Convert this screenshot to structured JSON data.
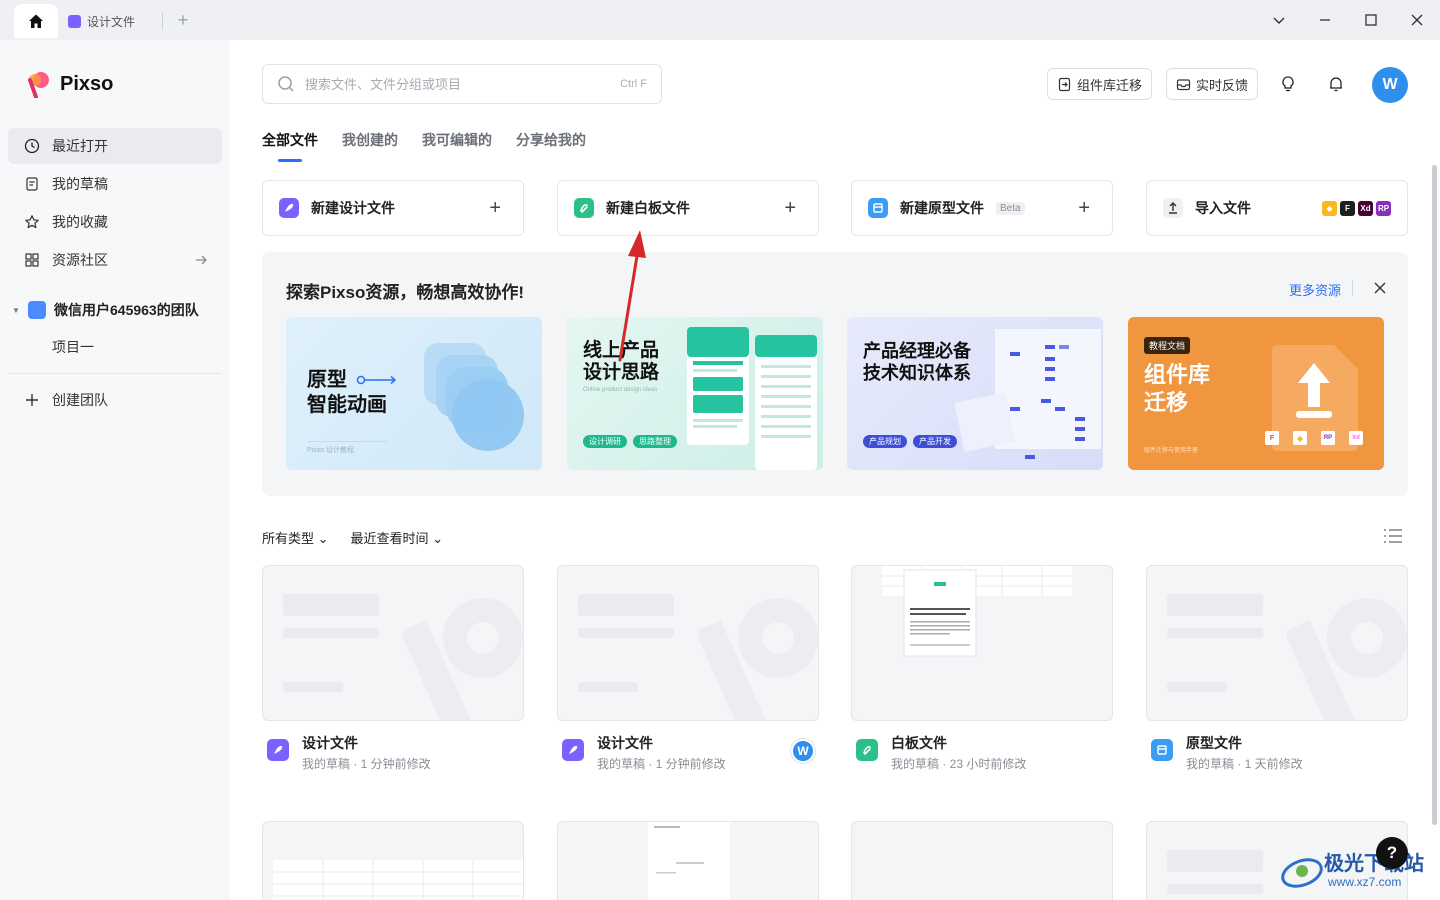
{
  "titlebar": {
    "tab_label": "设计文件",
    "new_tab": "+"
  },
  "app": {
    "name": "Pixso"
  },
  "sidebar": {
    "items": [
      {
        "label": "最近打开",
        "icon": "clock-icon"
      },
      {
        "label": "我的草稿",
        "icon": "draft-icon"
      },
      {
        "label": "我的收藏",
        "icon": "star-icon"
      },
      {
        "label": "资源社区",
        "icon": "grid-icon"
      }
    ],
    "team_name": "微信用户645963的团队",
    "project": "项目一",
    "create_team": "创建团队"
  },
  "search": {
    "placeholder": "搜索文件、文件分组或项目",
    "shortcut": "Ctrl F"
  },
  "header": {
    "migrate_btn": "组件库迁移",
    "feedback_btn": "实时反馈",
    "avatar": "W"
  },
  "tabs": [
    "全部文件",
    "我创建的",
    "我可编辑的",
    "分享给我的"
  ],
  "new_cards": [
    {
      "label": "新建设计文件",
      "color": "#7b61ff"
    },
    {
      "label": "新建白板文件",
      "color": "#2ec08a"
    },
    {
      "label": "新建原型文件",
      "badge": "Beta",
      "color": "#3b9cf5"
    },
    {
      "label": "导入文件",
      "logos": [
        "Xd",
        "RP"
      ]
    }
  ],
  "explore": {
    "title": "探索Pixso资源，畅想高效协作!",
    "more": "更多资源",
    "banners": [
      {
        "title_line1": "原型",
        "title_line2": "智能动画",
        "footer": "Pixso 设计教程"
      },
      {
        "title_line1": "线上产品",
        "title_line2": "设计思路",
        "subtitle": "Online product design ideas",
        "tags": [
          "设计调研",
          "思路整理"
        ]
      },
      {
        "title_line1": "产品经理必备",
        "title_line2": "技术知识体系",
        "tags": [
          "产品规划",
          "产品开发"
        ]
      },
      {
        "badge": "教程文档",
        "title_line1": "组件库",
        "title_line2": "迁移",
        "footer": "组件迁移与使用手册",
        "logos": [
          "RP",
          "Xd"
        ]
      }
    ]
  },
  "filters": {
    "type": "所有类型",
    "sort": "最近查看时间"
  },
  "files": [
    {
      "name": "设计文件",
      "meta": "我的草稿 · 1 分钟前修改",
      "kind": "design"
    },
    {
      "name": "设计文件",
      "meta": "我的草稿 · 1 分钟前修改",
      "kind": "design",
      "avatar": "W"
    },
    {
      "name": "白板文件",
      "meta": "我的草稿 · 23 小时前修改",
      "kind": "whiteboard"
    },
    {
      "name": "原型文件",
      "meta": "我的草稿 · 1 天前修改",
      "kind": "prototype"
    }
  ],
  "help": "?",
  "watermark": {
    "text": "极光下载站",
    "url": "www.xz7.com"
  },
  "colors": {
    "accent": "#2a6ff7",
    "design": "#7b61ff",
    "whiteboard": "#2ec08a",
    "prototype": "#3b9cf5",
    "annotation": "#d62828"
  }
}
